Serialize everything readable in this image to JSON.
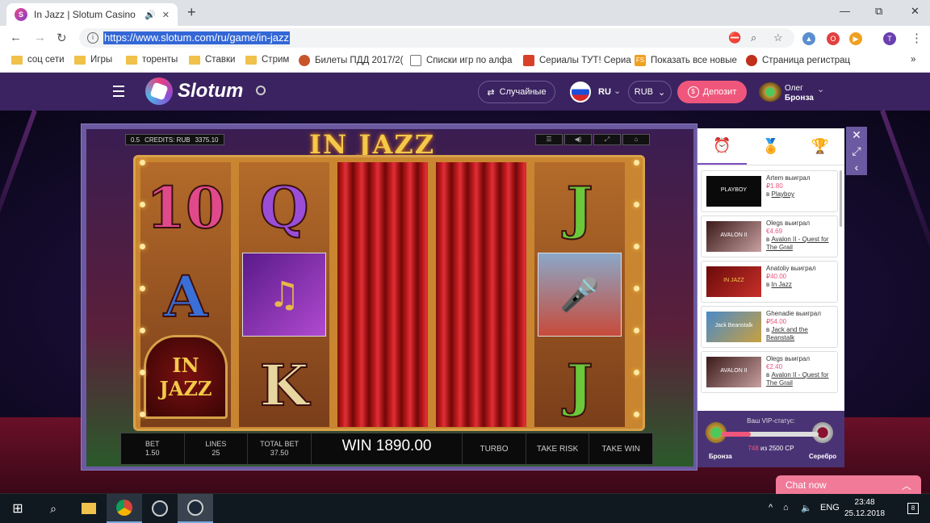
{
  "browser": {
    "tab_title": "In Jazz | Slotum Casino",
    "url": "https://www.slotum.com/ru/game/in-jazz",
    "new_tab": "+",
    "minimize": "—",
    "maximize": "⧉",
    "close": "✕"
  },
  "bookmarks": [
    {
      "label": "соц сети",
      "icon": "folder-icon"
    },
    {
      "label": "Игры",
      "icon": "folder-icon"
    },
    {
      "label": "торенты",
      "icon": "folder-icon"
    },
    {
      "label": "Ставки",
      "icon": "folder-icon"
    },
    {
      "label": "Стрим",
      "icon": "folder-icon"
    },
    {
      "label": "Билеты ПДД 2017/2(",
      "icon": "badge-icon"
    },
    {
      "label": "Списки игр по алфа",
      "icon": "page-icon"
    },
    {
      "label": "Сериалы ТУТ! Сериа",
      "icon": "guitar-icon"
    },
    {
      "label": "Показать все новые",
      "icon": "fs-icon"
    },
    {
      "label": "Страница регистрац",
      "icon": "fire-icon"
    }
  ],
  "bookmarks_more": "»",
  "site": {
    "brand": "Slotum",
    "random_label": "Случайные",
    "lang": "RU",
    "currency": "RUB",
    "deposit_label": "Депозит",
    "user_name": "Олег",
    "user_level": "Бронза"
  },
  "game": {
    "title": "IN JAZZ",
    "credits_bet": "0.5",
    "credits_label": "CREDITS: RUB",
    "credits_value": "3375.10",
    "bet_label": "BET",
    "bet_value": "1.50",
    "lines_label": "LINES",
    "lines_value": "25",
    "total_label": "TOTAL BET",
    "total_value": "37.50",
    "win_text": "WIN 1890.00",
    "turbo": "TURBO",
    "take_risk": "TAKE RISK",
    "take_win": "TAKE WIN",
    "symbols": {
      "ten": "10",
      "q": "Q",
      "a": "A",
      "k": "K",
      "j1": "J",
      "j2": "J",
      "logo": "IN JAZZ"
    }
  },
  "panel": {
    "wins": [
      {
        "player": "Artem выиграл",
        "amount": "₽1.80",
        "prefix": "в",
        "game": "Playboy",
        "thumb": "PLAYBOY"
      },
      {
        "player": "Olegs выиграл",
        "amount": "€4.69",
        "prefix": "в",
        "game": "Avalon II - Quest for The Grail",
        "thumb": "AVALON II"
      },
      {
        "player": "Anatoliy выиграл",
        "amount": "₽40.00",
        "prefix": "в",
        "game": "In Jazz",
        "thumb": "IN JAZZ"
      },
      {
        "player": "Ghenadie выиграл",
        "amount": "₽54.00",
        "prefix": "в",
        "game": "Jack and the Beanstalk",
        "thumb": "Jack Beanstalk"
      },
      {
        "player": "Olegs выиграл",
        "amount": "€2.40",
        "prefix": "в",
        "game": "Avalon II - Quest for The Grail",
        "thumb": "AVALON II"
      }
    ],
    "vip_label": "Ваш VIP-статус:",
    "vip_points": "748",
    "vip_of": "из 2500 СР",
    "vip_progress": 0.3,
    "level_from": "Бронза",
    "level_to": "Серебро"
  },
  "chat": {
    "label": "Chat now"
  },
  "taskbar": {
    "lang": "ENG",
    "time": "23:48",
    "date": "25.12.2018",
    "notifications": "8"
  },
  "colors": {
    "header": "#3a2360",
    "accent": "#f0567c",
    "panel_purple": "#4a3375"
  }
}
